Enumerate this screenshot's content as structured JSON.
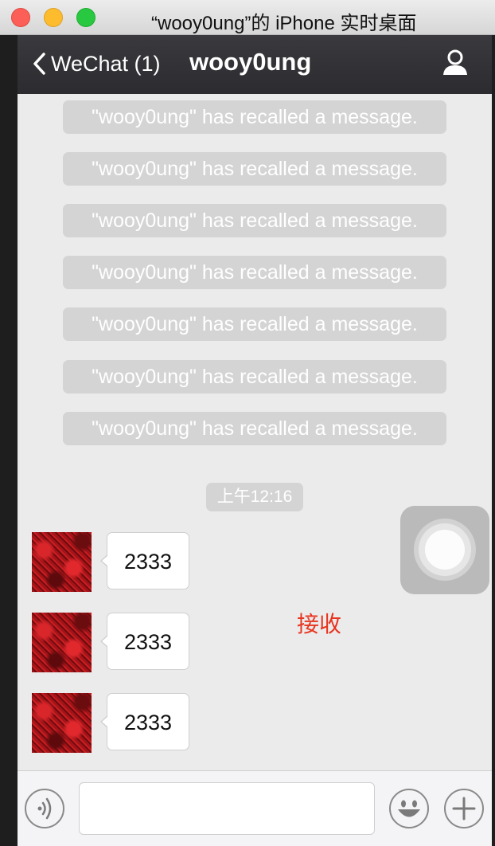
{
  "window": {
    "title": "“wooy0ung”的 iPhone 实时桌面"
  },
  "navbar": {
    "back_label": "WeChat (1)",
    "title": "wooy0ung",
    "profile_icon": "person-icon"
  },
  "chat": {
    "recalled_messages": [
      "\"wooy0ung\" has recalled a message.",
      "\"wooy0ung\" has recalled a message.",
      "\"wooy0ung\" has recalled a message.",
      "\"wooy0ung\" has recalled a message.",
      "\"wooy0ung\" has recalled a message.",
      "\"wooy0ung\" has recalled a message.",
      "\"wooy0ung\" has recalled a message."
    ],
    "timestamp": "上午12:16",
    "messages": [
      {
        "text": "2333"
      },
      {
        "text": "2333"
      },
      {
        "text": "2333"
      }
    ]
  },
  "overlay": {
    "annotation": "接收",
    "annotation_color": "#e8341f"
  },
  "toolbar": {
    "voice_icon": "voice-icon",
    "input_value": "",
    "emoji_icon": "emoji-icon",
    "more_icon": "plus-icon"
  }
}
